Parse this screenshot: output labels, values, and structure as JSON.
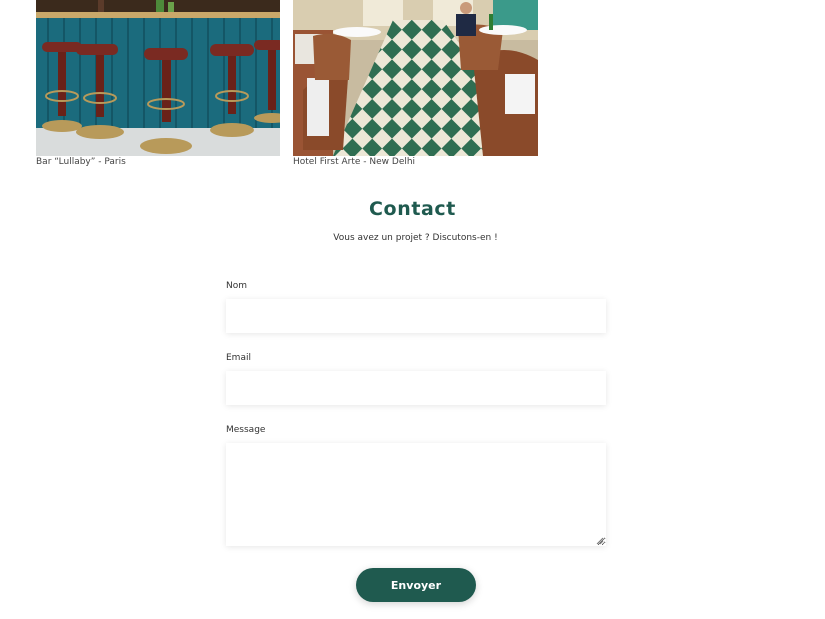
{
  "gallery": {
    "items": [
      {
        "caption": "Bar “Lullaby” - Paris"
      },
      {
        "caption": "Hotel First Arte - New Delhi"
      }
    ]
  },
  "contact": {
    "title": "Contact",
    "subtitle": "Vous avez un projet ? Discutons-en !",
    "fields": {
      "name_label": "Nom",
      "name_value": "",
      "email_label": "Email",
      "email_value": "",
      "message_label": "Message",
      "message_value": ""
    },
    "submit_label": "Envoyer"
  },
  "colors": {
    "accent": "#1f5a4f",
    "bar_wall": "#1b6b7d",
    "stool_seat": "#7a2a22",
    "brass": "#b89a5a",
    "floor_green": "#2f6e52",
    "floor_cream": "#ece7d6",
    "wicker": "#8a4a2a"
  }
}
